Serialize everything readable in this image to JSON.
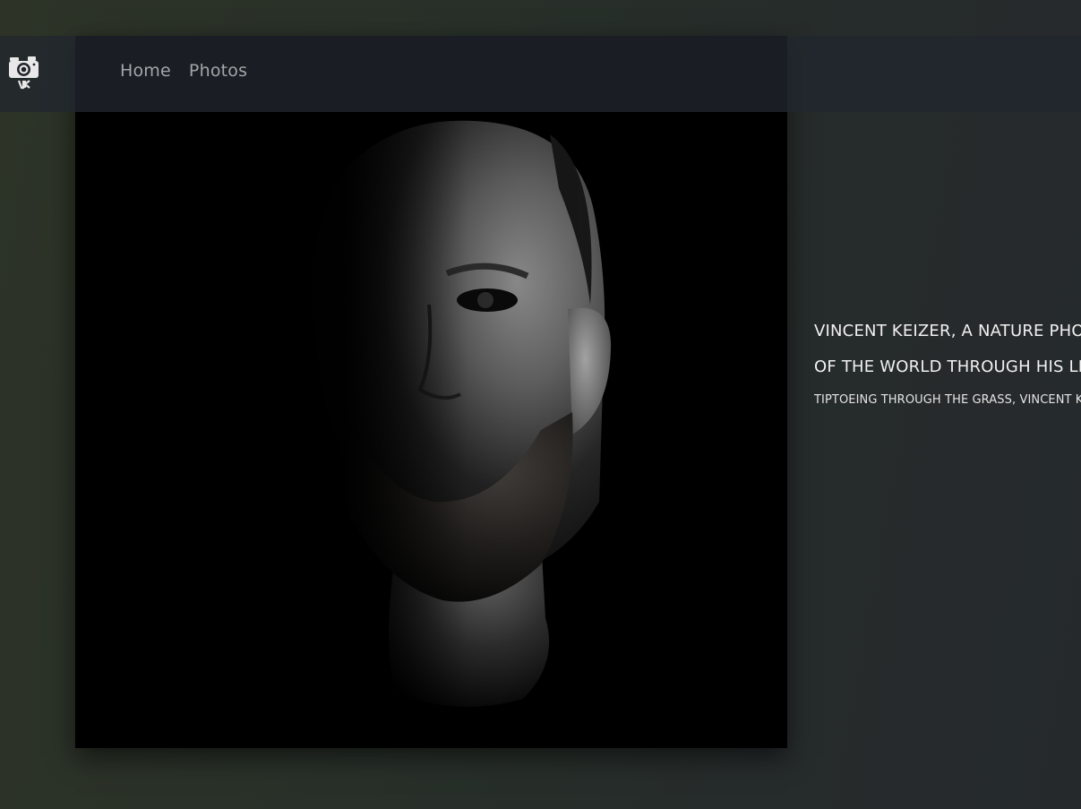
{
  "nav": {
    "logo_icon": "camera-vk-logo-icon",
    "links": [
      {
        "label": "Home"
      },
      {
        "label": "Photos"
      }
    ]
  },
  "hero": {
    "image_icon": "portrait-photo",
    "headline_line1": "VINCENT KEIZER, A NATURE PHOT",
    "headline_line2": "OF THE WORLD THROUGH HIS LE",
    "subline": "TIPTOEING THROUGH THE GRASS, VINCENT KN"
  },
  "colors": {
    "background": "#283029",
    "navbar": "#21262e",
    "text": "#f1f1f1",
    "nav_text": "#a3a6a8"
  }
}
